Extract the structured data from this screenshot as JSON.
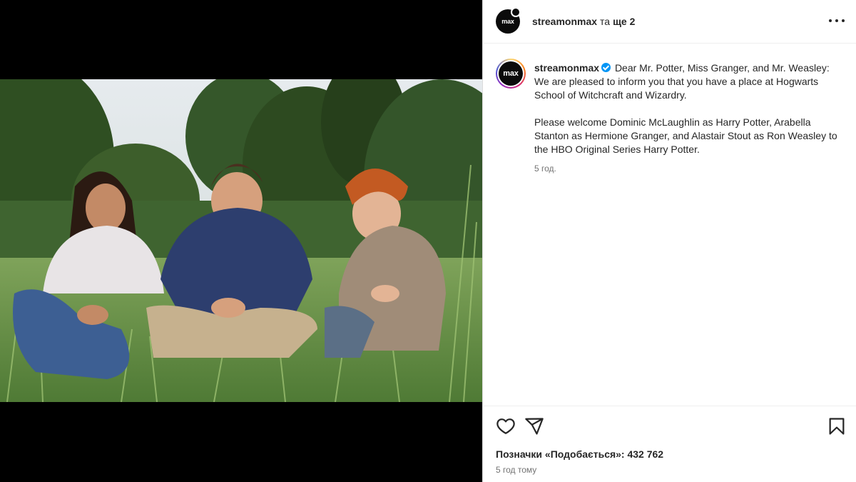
{
  "header": {
    "username": "streamonmax",
    "and_text": "та",
    "more_text": "ще 2"
  },
  "logo": {
    "text": "max"
  },
  "caption": {
    "username": "streamonmax",
    "paragraph1": "Dear Mr. Potter, Miss Granger, and Mr. Weasley: We are pleased to inform you that you have a place at Hogwarts School of Witchcraft and Wizardry.",
    "paragraph2": "Please welcome Dominic McLaughlin as Harry Potter, Arabella Stanton as Hermione Granger, and Alastair Stout as Ron Weasley to the HBO Original Series Harry Potter.",
    "time": "5 год."
  },
  "footer": {
    "likes_text": "Позначки «Подобається»: 432 762",
    "time_text": "5 год тому"
  },
  "icons": {
    "like": "heart-icon",
    "share": "send-icon",
    "save": "bookmark-icon",
    "options": "more-options-icon",
    "verified": "verified-badge-icon"
  },
  "colors": {
    "verified": "#0095f6",
    "text": "#262626",
    "secondary_text": "#737373",
    "media_background": "#000000"
  }
}
